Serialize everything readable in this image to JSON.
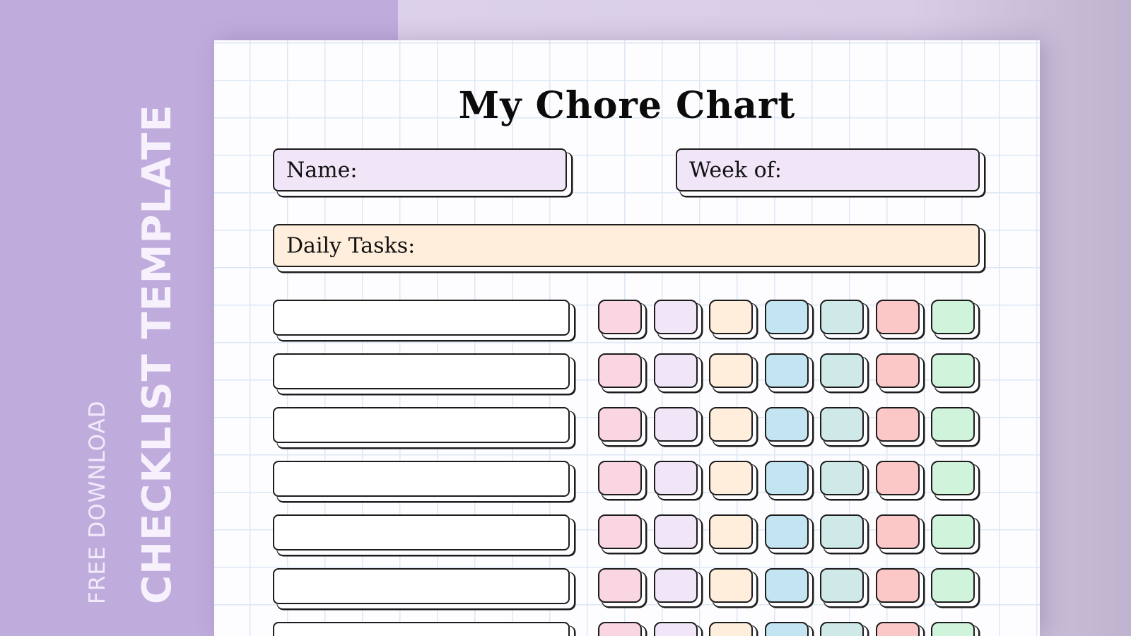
{
  "side": {
    "small_text": "FREE DOWNLOAD",
    "large_text": "CHECKLIST TEMPLATE"
  },
  "chart": {
    "title": "My Chore Chart",
    "name_label": "Name:",
    "week_label": "Week of:",
    "daily_label": "Daily Tasks:",
    "rows": 7,
    "columns": 7
  },
  "colors": {
    "name_box": "#f1e6f7",
    "week_box": "#f1e6f7",
    "daily_box": "#ffeedb",
    "day_cells": [
      "#fad6e3",
      "#f1e6f7",
      "#ffeedb",
      "#c3e4f1",
      "#cfe8e8",
      "#fbc7c7",
      "#cff3db"
    ]
  }
}
